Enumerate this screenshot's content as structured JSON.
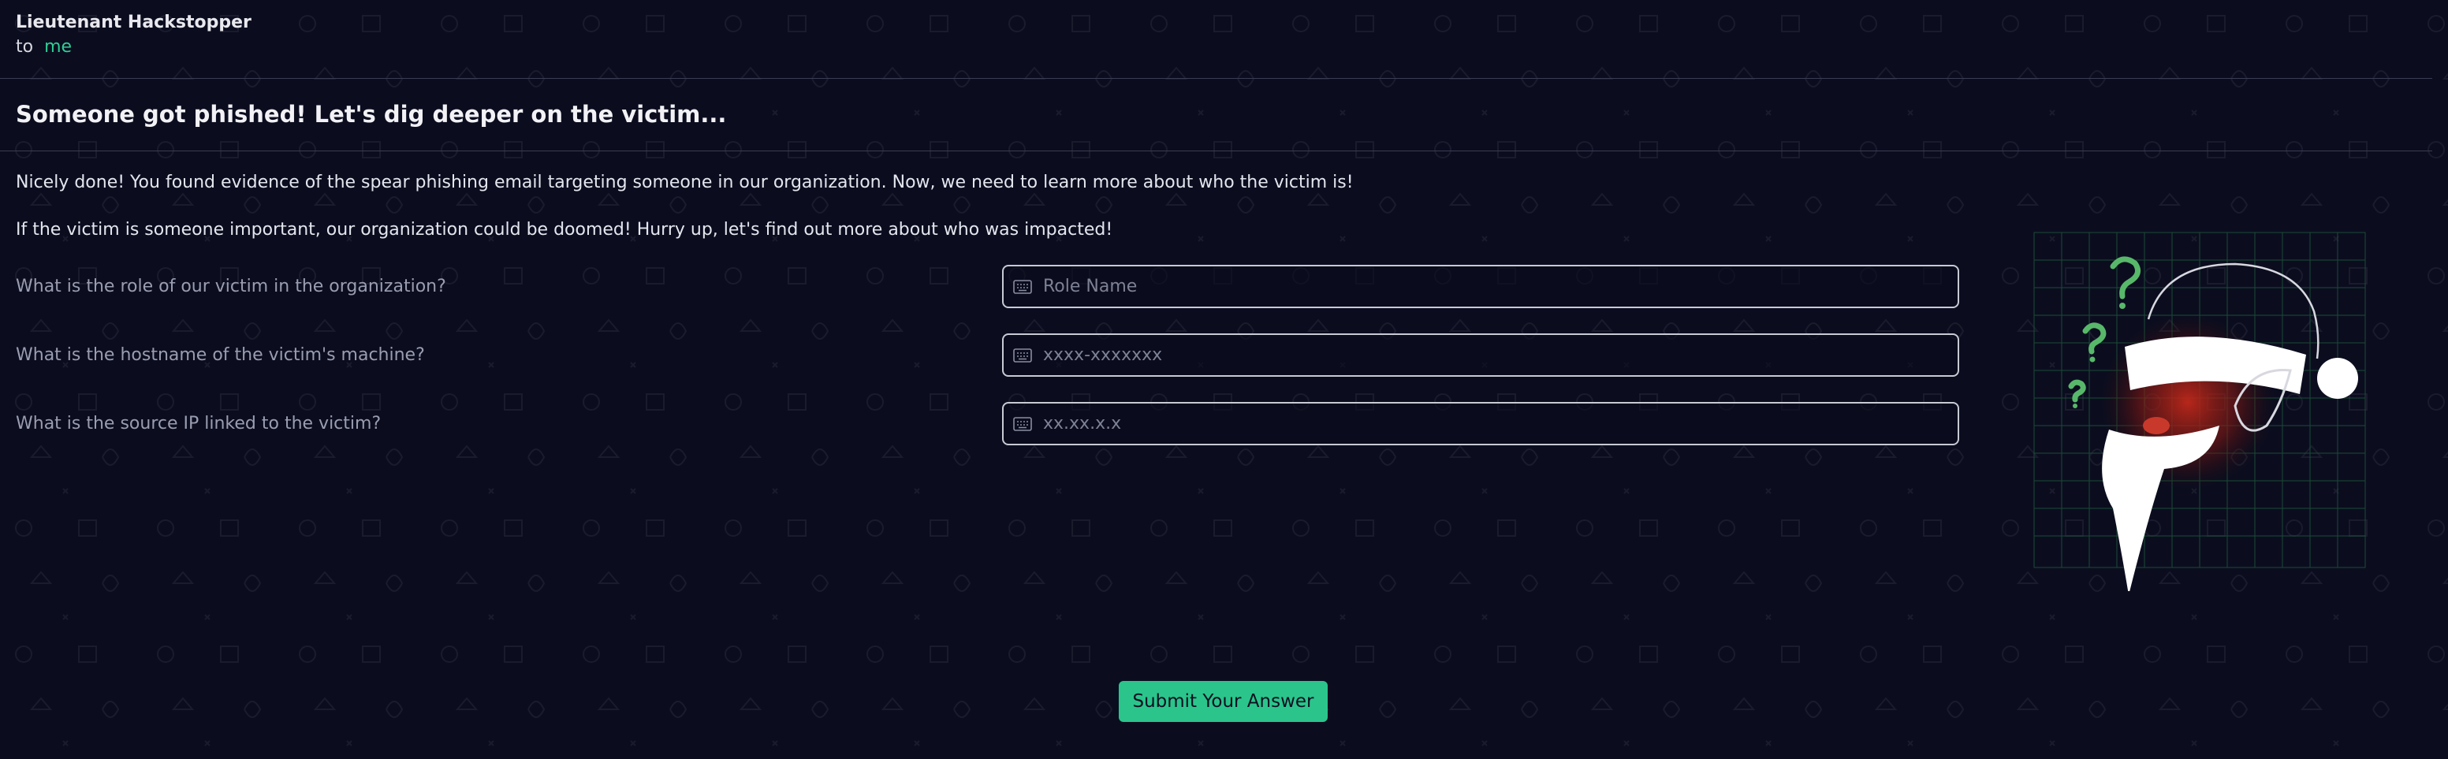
{
  "email": {
    "sender": "Lieutenant Hackstopper",
    "to_label": "to",
    "recipient": "me",
    "subject": "Someone got phished! Let's dig deeper on the victim...",
    "paragraphs": [
      "Nicely done! You found evidence of the spear phishing email targeting someone in our organization. Now, we need to learn more about who the victim is!",
      "If the victim is someone important, our organization could be doomed! Hurry up, let's find out more about who was impacted!"
    ]
  },
  "form": {
    "questions": [
      {
        "label": "What is the role of our victim in the organization?",
        "placeholder": "Role Name",
        "value": ""
      },
      {
        "label": "What is the hostname of the victim's machine?",
        "placeholder": "xxxx-xxxxxxx",
        "value": ""
      },
      {
        "label": "What is the source IP linked to the victim?",
        "placeholder": "xx.xx.x.x",
        "value": ""
      }
    ],
    "submit_label": "Submit Your Answer"
  },
  "icons": {
    "input_icon": "keyboard-icon",
    "illustration": "santa-hat-question-icon"
  },
  "colors": {
    "background": "#0b0d1f",
    "accent": "#2bc58c",
    "recipient": "#2fcf95"
  }
}
